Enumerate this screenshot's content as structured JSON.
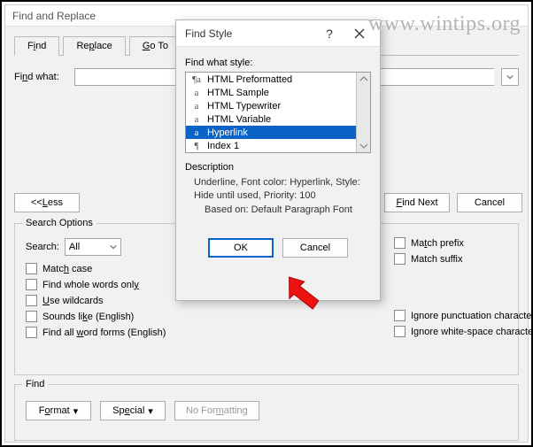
{
  "watermark": "www.wintips.org",
  "main": {
    "title": "Find and Replace",
    "tabs": {
      "find_pre": "F",
      "find_ul": "i",
      "find_post": "nd",
      "replace_pre": "Re",
      "replace_ul": "p",
      "replace_post": "lace",
      "goto_pre": "",
      "goto_ul": "G",
      "goto_post": "o To"
    },
    "find_what_label_pre": "Fi",
    "find_what_label_ul": "n",
    "find_what_label_post": "d what:",
    "find_what_value": "",
    "buttons": {
      "less_pre": "<< ",
      "less_ul": "L",
      "less_post": "ess",
      "findnext_pre": "",
      "findnext_ul": "F",
      "findnext_post": "ind Next",
      "cancel": "Cancel"
    },
    "search_options": {
      "label": "Search Options",
      "search_label": "Search:",
      "direction": "All",
      "cb": {
        "match_case_pre": "Matc",
        "match_case_ul": "h",
        "match_case_post": " case",
        "whole_pre": "Find whole words onl",
        "whole_ul": "y",
        "whole_post": "",
        "wild_pre": "",
        "wild_ul": "U",
        "wild_post": "se wildcards",
        "sounds_pre": "Sounds li",
        "sounds_ul": "k",
        "sounds_post": "e (English)",
        "allforms_pre": "Find all ",
        "allforms_ul": "w",
        "allforms_post": "ord forms (English)",
        "prefix_pre": "Ma",
        "prefix_ul": "t",
        "prefix_post": "ch prefix",
        "suffix": "Match suffix",
        "punct_pre": "Ignore punctuation character",
        "punct_ul": "s",
        "punct_post": "",
        "ws_pre": "Ignore white-space character",
        "ws_ul": "s",
        "ws_post": ""
      }
    },
    "find_section": {
      "label": "Find",
      "format_pre": "F",
      "format_ul": "o",
      "format_post": "rmat",
      "special_pre": "Sp",
      "special_ul": "e",
      "special_post": "cial",
      "noformatting_pre": "No For",
      "noformatting_ul": "m",
      "noformatting_post": "atting"
    }
  },
  "modal": {
    "title": "Find Style",
    "help": "?",
    "close": "✕",
    "list_label": "Find what style:",
    "items": [
      {
        "glyph": "¶a",
        "label": "HTML Preformatted"
      },
      {
        "glyph": "a",
        "label": "HTML Sample"
      },
      {
        "glyph": "a",
        "label": "HTML Typewriter"
      },
      {
        "glyph": "a",
        "label": "HTML Variable"
      },
      {
        "glyph": "a",
        "label": "Hyperlink"
      },
      {
        "glyph": "¶",
        "label": "Index 1"
      }
    ],
    "selected_index": 4,
    "description_label": "Description",
    "description_line1": "Underline, Font color: Hyperlink, Style:",
    "description_line2": "Hide until used, Priority: 100",
    "description_line3": "Based on: Default Paragraph Font",
    "ok": "OK",
    "cancel": "Cancel"
  }
}
